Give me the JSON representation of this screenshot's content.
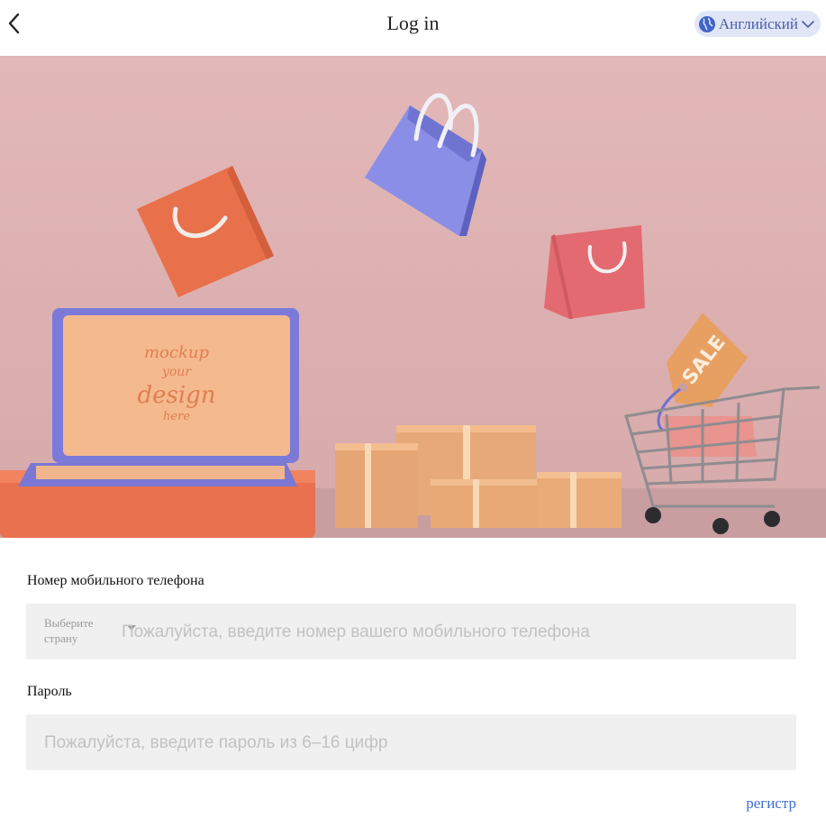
{
  "header": {
    "title": "Log in",
    "language": "Английский"
  },
  "hero": {
    "laptop_screen_text": [
      "mockup",
      "your",
      "design",
      "here"
    ],
    "sale_tag": "SALE"
  },
  "form": {
    "phone_label": "Номер мобильного телефона",
    "country_select_label": "Выберите страну",
    "phone_placeholder": "Пожалуйста, введите номер вашего мобильного телефона",
    "phone_value": "",
    "password_label": "Пароль",
    "password_placeholder": "Пожалуйста, введите пароль из 6–16 цифр",
    "password_value": ""
  },
  "links": {
    "register": "регистр"
  },
  "colors": {
    "lang_bg": "#e1e6f7",
    "lang_text": "#4a5ea8",
    "link": "#3f6ed8",
    "input_bg": "#f0f0f0",
    "hero_bg": "#e3b9b9"
  },
  "icons": {
    "back": "chevron-left-icon",
    "globe": "globe-icon",
    "dropdown": "chevron-down-icon",
    "country_caret": "caret-down-icon"
  }
}
